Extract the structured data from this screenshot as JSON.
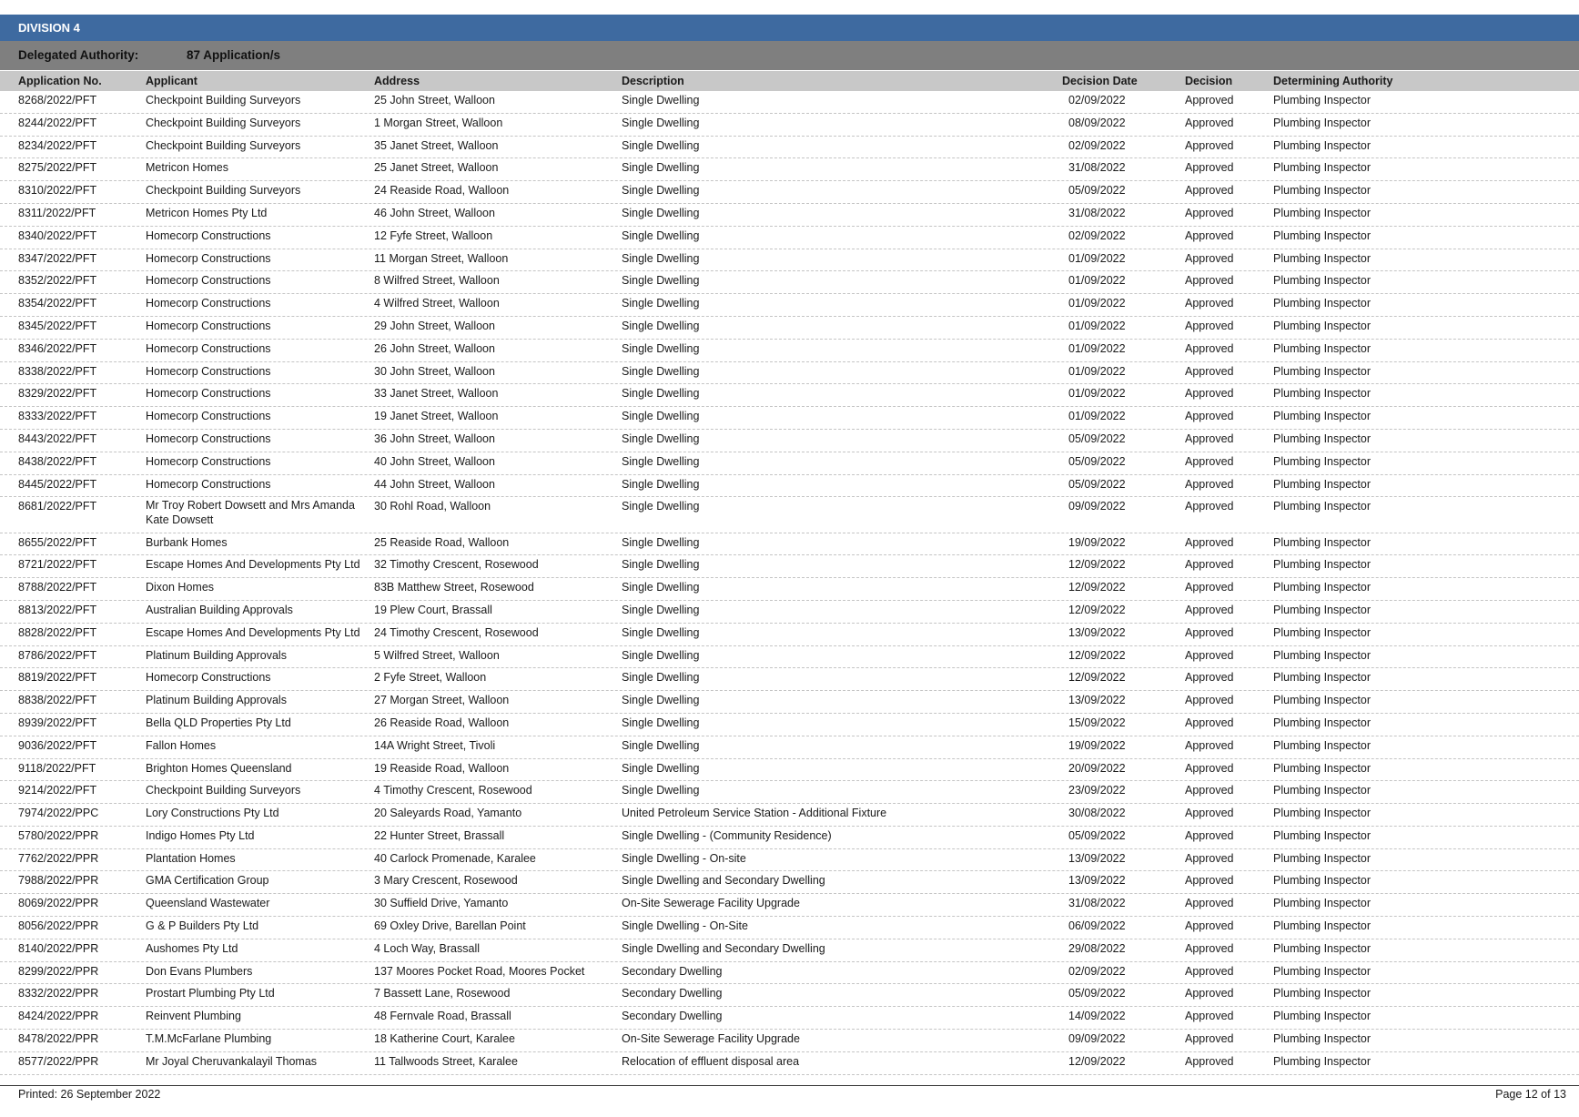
{
  "division": "DIVISION 4",
  "delegated": {
    "label": "Delegated Authority:",
    "count": "87 Application/s"
  },
  "columns": {
    "app_no": "Application No.",
    "applicant": "Applicant",
    "address": "Address",
    "description": "Description",
    "decision_date": "Decision Date",
    "decision": "Decision",
    "authority": "Determining Authority"
  },
  "rows": [
    {
      "app_no": "8268/2022/PFT",
      "applicant": "Checkpoint Building Surveyors",
      "address": "25 John Street, Walloon",
      "description": "Single Dwelling",
      "date": "02/09/2022",
      "decision": "Approved",
      "authority": "Plumbing Inspector"
    },
    {
      "app_no": "8244/2022/PFT",
      "applicant": "Checkpoint Building Surveyors",
      "address": "1 Morgan Street, Walloon",
      "description": "Single Dwelling",
      "date": "08/09/2022",
      "decision": "Approved",
      "authority": "Plumbing Inspector"
    },
    {
      "app_no": "8234/2022/PFT",
      "applicant": "Checkpoint Building Surveyors",
      "address": "35 Janet Street, Walloon",
      "description": "Single Dwelling",
      "date": "02/09/2022",
      "decision": "Approved",
      "authority": "Plumbing Inspector"
    },
    {
      "app_no": "8275/2022/PFT",
      "applicant": "Metricon Homes",
      "address": "25 Janet Street, Walloon",
      "description": "Single Dwelling",
      "date": "31/08/2022",
      "decision": "Approved",
      "authority": "Plumbing Inspector"
    },
    {
      "app_no": "8310/2022/PFT",
      "applicant": "Checkpoint Building Surveyors",
      "address": "24 Reaside Road, Walloon",
      "description": "Single Dwelling",
      "date": "05/09/2022",
      "decision": "Approved",
      "authority": "Plumbing Inspector"
    },
    {
      "app_no": "8311/2022/PFT",
      "applicant": "Metricon Homes Pty Ltd",
      "address": "46 John Street, Walloon",
      "description": "Single Dwelling",
      "date": "31/08/2022",
      "decision": "Approved",
      "authority": "Plumbing Inspector"
    },
    {
      "app_no": "8340/2022/PFT",
      "applicant": "Homecorp Constructions",
      "address": "12 Fyfe Street, Walloon",
      "description": "Single Dwelling",
      "date": "02/09/2022",
      "decision": "Approved",
      "authority": "Plumbing Inspector"
    },
    {
      "app_no": "8347/2022/PFT",
      "applicant": "Homecorp Constructions",
      "address": "11 Morgan Street, Walloon",
      "description": "Single Dwelling",
      "date": "01/09/2022",
      "decision": "Approved",
      "authority": "Plumbing Inspector"
    },
    {
      "app_no": "8352/2022/PFT",
      "applicant": "Homecorp Constructions",
      "address": "8 Wilfred Street, Walloon",
      "description": "Single Dwelling",
      "date": "01/09/2022",
      "decision": "Approved",
      "authority": "Plumbing Inspector"
    },
    {
      "app_no": "8354/2022/PFT",
      "applicant": "Homecorp Constructions",
      "address": "4 Wilfred Street, Walloon",
      "description": "Single Dwelling",
      "date": "01/09/2022",
      "decision": "Approved",
      "authority": "Plumbing Inspector"
    },
    {
      "app_no": "8345/2022/PFT",
      "applicant": "Homecorp Constructions",
      "address": "29 John Street, Walloon",
      "description": "Single Dwelling",
      "date": "01/09/2022",
      "decision": "Approved",
      "authority": "Plumbing Inspector"
    },
    {
      "app_no": "8346/2022/PFT",
      "applicant": "Homecorp Constructions",
      "address": "26 John Street, Walloon",
      "description": "Single Dwelling",
      "date": "01/09/2022",
      "decision": "Approved",
      "authority": "Plumbing Inspector"
    },
    {
      "app_no": "8338/2022/PFT",
      "applicant": "Homecorp Constructions",
      "address": "30 John Street, Walloon",
      "description": "Single Dwelling",
      "date": "01/09/2022",
      "decision": "Approved",
      "authority": "Plumbing Inspector"
    },
    {
      "app_no": "8329/2022/PFT",
      "applicant": "Homecorp Constructions",
      "address": "33 Janet Street, Walloon",
      "description": "Single Dwelling",
      "date": "01/09/2022",
      "decision": "Approved",
      "authority": "Plumbing Inspector"
    },
    {
      "app_no": "8333/2022/PFT",
      "applicant": "Homecorp Constructions",
      "address": "19 Janet Street, Walloon",
      "description": "Single Dwelling",
      "date": "01/09/2022",
      "decision": "Approved",
      "authority": "Plumbing Inspector"
    },
    {
      "app_no": "8443/2022/PFT",
      "applicant": "Homecorp Constructions",
      "address": "36 John Street, Walloon",
      "description": "Single Dwelling",
      "date": "05/09/2022",
      "decision": "Approved",
      "authority": "Plumbing Inspector"
    },
    {
      "app_no": "8438/2022/PFT",
      "applicant": "Homecorp Constructions",
      "address": "40 John Street, Walloon",
      "description": "Single Dwelling",
      "date": "05/09/2022",
      "decision": "Approved",
      "authority": "Plumbing Inspector"
    },
    {
      "app_no": "8445/2022/PFT",
      "applicant": "Homecorp Constructions",
      "address": "44 John Street, Walloon",
      "description": "Single Dwelling",
      "date": "05/09/2022",
      "decision": "Approved",
      "authority": "Plumbing Inspector"
    },
    {
      "app_no": "8681/2022/PFT",
      "applicant": "Mr Troy Robert Dowsett and Mrs Amanda Kate Dowsett",
      "address": "30 Rohl Road, Walloon",
      "description": "Single Dwelling",
      "date": "09/09/2022",
      "decision": "Approved",
      "authority": "Plumbing Inspector"
    },
    {
      "app_no": "8655/2022/PFT",
      "applicant": "Burbank Homes",
      "address": "25 Reaside Road, Walloon",
      "description": "Single Dwelling",
      "date": "19/09/2022",
      "decision": "Approved",
      "authority": "Plumbing Inspector"
    },
    {
      "app_no": "8721/2022/PFT",
      "applicant": "Escape Homes And Developments Pty Ltd",
      "address": "32 Timothy Crescent, Rosewood",
      "description": "Single Dwelling",
      "date": "12/09/2022",
      "decision": "Approved",
      "authority": "Plumbing Inspector"
    },
    {
      "app_no": "8788/2022/PFT",
      "applicant": "Dixon Homes",
      "address": "83B Matthew Street, Rosewood",
      "description": "Single Dwelling",
      "date": "12/09/2022",
      "decision": "Approved",
      "authority": "Plumbing Inspector"
    },
    {
      "app_no": "8813/2022/PFT",
      "applicant": "Australian Building Approvals",
      "address": "19 Plew Court, Brassall",
      "description": "Single Dwelling",
      "date": "12/09/2022",
      "decision": "Approved",
      "authority": "Plumbing Inspector"
    },
    {
      "app_no": "8828/2022/PFT",
      "applicant": "Escape Homes And Developments Pty Ltd",
      "address": "24 Timothy Crescent, Rosewood",
      "description": "Single Dwelling",
      "date": "13/09/2022",
      "decision": "Approved",
      "authority": "Plumbing Inspector"
    },
    {
      "app_no": "8786/2022/PFT",
      "applicant": "Platinum Building Approvals",
      "address": "5 Wilfred Street, Walloon",
      "description": "Single Dwelling",
      "date": "12/09/2022",
      "decision": "Approved",
      "authority": "Plumbing Inspector"
    },
    {
      "app_no": "8819/2022/PFT",
      "applicant": "Homecorp Constructions",
      "address": "2 Fyfe Street, Walloon",
      "description": "Single Dwelling",
      "date": "12/09/2022",
      "decision": "Approved",
      "authority": "Plumbing Inspector"
    },
    {
      "app_no": "8838/2022/PFT",
      "applicant": "Platinum Building Approvals",
      "address": "27 Morgan Street, Walloon",
      "description": "Single Dwelling",
      "date": "13/09/2022",
      "decision": "Approved",
      "authority": "Plumbing Inspector"
    },
    {
      "app_no": "8939/2022/PFT",
      "applicant": "Bella QLD Properties Pty Ltd",
      "address": "26 Reaside Road, Walloon",
      "description": "Single Dwelling",
      "date": "15/09/2022",
      "decision": "Approved",
      "authority": "Plumbing Inspector"
    },
    {
      "app_no": "9036/2022/PFT",
      "applicant": "Fallon Homes",
      "address": "14A Wright Street, Tivoli",
      "description": "Single Dwelling",
      "date": "19/09/2022",
      "decision": "Approved",
      "authority": "Plumbing Inspector"
    },
    {
      "app_no": "9118/2022/PFT",
      "applicant": "Brighton Homes Queensland",
      "address": "19 Reaside Road, Walloon",
      "description": "Single Dwelling",
      "date": "20/09/2022",
      "decision": "Approved",
      "authority": "Plumbing Inspector"
    },
    {
      "app_no": "9214/2022/PFT",
      "applicant": "Checkpoint Building Surveyors",
      "address": "4 Timothy Crescent, Rosewood",
      "description": "Single Dwelling",
      "date": "23/09/2022",
      "decision": "Approved",
      "authority": "Plumbing Inspector"
    },
    {
      "app_no": "7974/2022/PPC",
      "applicant": "Lory Constructions Pty Ltd",
      "address": "20 Saleyards Road, Yamanto",
      "description": "United Petroleum Service Station - Additional Fixture",
      "date": "30/08/2022",
      "decision": "Approved",
      "authority": "Plumbing Inspector"
    },
    {
      "app_no": "5780/2022/PPR",
      "applicant": "Indigo Homes Pty Ltd",
      "address": "22 Hunter Street, Brassall",
      "description": "Single Dwelling - (Community Residence)",
      "date": "05/09/2022",
      "decision": "Approved",
      "authority": "Plumbing Inspector"
    },
    {
      "app_no": "7762/2022/PPR",
      "applicant": "Plantation Homes",
      "address": "40 Carlock Promenade, Karalee",
      "description": "Single Dwelling - On-site",
      "date": "13/09/2022",
      "decision": "Approved",
      "authority": "Plumbing Inspector"
    },
    {
      "app_no": "7988/2022/PPR",
      "applicant": "GMA Certification Group",
      "address": "3 Mary Crescent, Rosewood",
      "description": "Single Dwelling and Secondary Dwelling",
      "date": "13/09/2022",
      "decision": "Approved",
      "authority": "Plumbing Inspector"
    },
    {
      "app_no": "8069/2022/PPR",
      "applicant": "Queensland Wastewater",
      "address": "30 Suffield Drive, Yamanto",
      "description": "On-Site Sewerage Facility Upgrade",
      "date": "31/08/2022",
      "decision": "Approved",
      "authority": "Plumbing Inspector"
    },
    {
      "app_no": "8056/2022/PPR",
      "applicant": "G & P Builders Pty Ltd",
      "address": "69 Oxley Drive, Barellan Point",
      "description": "Single Dwelling - On-Site",
      "date": "06/09/2022",
      "decision": "Approved",
      "authority": "Plumbing Inspector"
    },
    {
      "app_no": "8140/2022/PPR",
      "applicant": "Aushomes Pty Ltd",
      "address": "4 Loch Way, Brassall",
      "description": "Single Dwelling and Secondary Dwelling",
      "date": "29/08/2022",
      "decision": "Approved",
      "authority": "Plumbing Inspector"
    },
    {
      "app_no": "8299/2022/PPR",
      "applicant": "Don Evans Plumbers",
      "address": "137 Moores Pocket Road, Moores Pocket",
      "description": "Secondary Dwelling",
      "date": "02/09/2022",
      "decision": "Approved",
      "authority": "Plumbing Inspector"
    },
    {
      "app_no": "8332/2022/PPR",
      "applicant": "Prostart Plumbing Pty Ltd",
      "address": "7 Bassett Lane, Rosewood",
      "description": "Secondary Dwelling",
      "date": "05/09/2022",
      "decision": "Approved",
      "authority": "Plumbing Inspector"
    },
    {
      "app_no": "8424/2022/PPR",
      "applicant": "Reinvent Plumbing",
      "address": "48 Fernvale Road, Brassall",
      "description": "Secondary Dwelling",
      "date": "14/09/2022",
      "decision": "Approved",
      "authority": "Plumbing Inspector"
    },
    {
      "app_no": "8478/2022/PPR",
      "applicant": "T.M.McFarlane Plumbing",
      "address": "18 Katherine Court, Karalee",
      "description": "On-Site Sewerage Facility Upgrade",
      "date": "09/09/2022",
      "decision": "Approved",
      "authority": "Plumbing Inspector"
    },
    {
      "app_no": "8577/2022/PPR",
      "applicant": "Mr Joyal Cheruvankalayil Thomas",
      "address": "11 Tallwoods Street, Karalee",
      "description": "Relocation of effluent disposal area",
      "date": "12/09/2022",
      "decision": "Approved",
      "authority": "Plumbing Inspector"
    }
  ],
  "footer": {
    "printed": "Printed: 26 September 2022",
    "page": "Page 12 of 13"
  }
}
